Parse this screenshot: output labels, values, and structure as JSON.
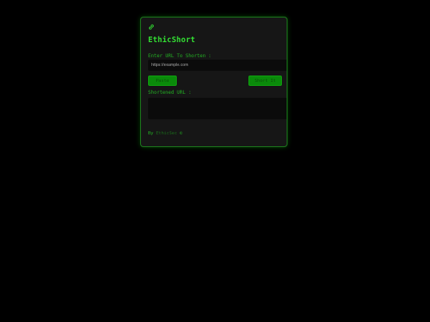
{
  "app": {
    "title": "EthicShort"
  },
  "form": {
    "url_label": "Enter URL To Shorten :",
    "url_placeholder": "https://example.com",
    "url_value": "",
    "paste_label": "Paste",
    "shorten_label": "Short It",
    "short_label": "Shortened URL :",
    "short_value": ""
  },
  "footer": {
    "prefix": "By ",
    "author": "EthicSec",
    "suffix": " ©"
  },
  "icons": {
    "link": "link-icon"
  },
  "colors": {
    "background": "#000000",
    "card": "#161616",
    "border": "#1d7a1d",
    "accent": "#33e033",
    "button": "#0a8a0a"
  }
}
